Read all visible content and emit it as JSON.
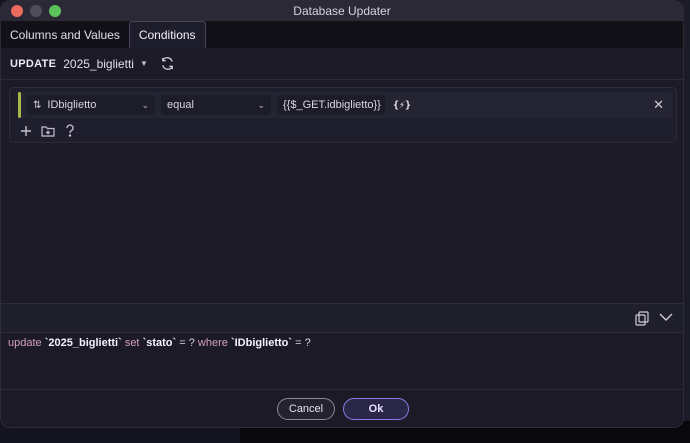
{
  "window": {
    "title": "Database Updater"
  },
  "tabs": [
    {
      "label": "Columns and Values",
      "active": false
    },
    {
      "label": "Conditions",
      "active": true
    }
  ],
  "update_bar": {
    "label": "UPDATE",
    "table": "2025_biglietti"
  },
  "condition": {
    "field": "IDbiglietto",
    "operator": "equal",
    "value": "{{$_GET.idbiglietto}}",
    "dynamic_label": "{⚡}"
  },
  "sql": {
    "kw_update": "update",
    "table": "`2025_biglietti`",
    "kw_set": "set",
    "column": "`stato`",
    "eq1": "= ?",
    "kw_where": "where",
    "where_column": "`IDbiglietto`",
    "eq2": "= ?"
  },
  "footer": {
    "cancel_label": "Cancel",
    "ok_label": "Ok"
  },
  "colors": {
    "accent": "#8b7ee6",
    "condition_marker": "#a7b84a",
    "sql_keyword": "#d4a0b8"
  }
}
